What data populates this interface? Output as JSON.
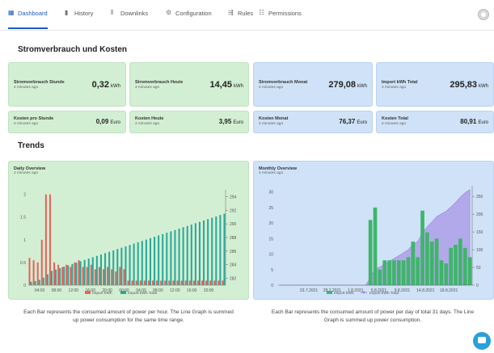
{
  "nav": {
    "tabs": [
      {
        "label": "Dashboard",
        "icon": "grid-icon"
      },
      {
        "label": "History",
        "icon": "bar-chart-icon"
      },
      {
        "label": "Downlinks",
        "icon": "bars-icon"
      },
      {
        "label": "Configuration",
        "icon": "gear-icon"
      },
      {
        "label": "Rules",
        "icon": "rules-icon"
      },
      {
        "label": "Permissions",
        "icon": "users-icon"
      }
    ],
    "active_tab": "Dashboard",
    "accent_color": "#1a5cc7"
  },
  "costs_section": {
    "title": "Stromverbrauch und Kosten",
    "cards": [
      {
        "title": "Stromverbrauch Stunde",
        "subtitle": "4 minutes ago",
        "value": "0,32",
        "unit": "kWh",
        "color": "green"
      },
      {
        "title": "Stromverbrauch Heute",
        "subtitle": "4 minutes ago",
        "value": "14,45",
        "unit": "kWh",
        "color": "green"
      },
      {
        "title": "Stromverbrauch Monat",
        "subtitle": "4 minutes ago",
        "value": "279,08",
        "unit": "kWh",
        "color": "blue"
      },
      {
        "title": "Import kWh Total",
        "subtitle": "4 minutes ago",
        "value": "295,83",
        "unit": "kWh",
        "color": "blue"
      },
      {
        "title": "Kosten pro Stunde",
        "subtitle": "4 minutes ago",
        "value": "0,09",
        "unit": "Euro",
        "color": "green"
      },
      {
        "title": "Kosten Heute",
        "subtitle": "4 minutes ago",
        "value": "3,95",
        "unit": "Euro",
        "color": "green"
      },
      {
        "title": "Kosten Monat",
        "subtitle": "4 minutes ago",
        "value": "76,37",
        "unit": "Euro",
        "color": "blue"
      },
      {
        "title": "Kosten Total",
        "subtitle": "4 minutes ago",
        "value": "80,91",
        "unit": "Euro",
        "color": "blue"
      }
    ]
  },
  "trends_section": {
    "title": "Trends",
    "daily_description": "Each Bar represents the consumed amount of power per hour. The Line Graph is summed up power consumption for the same time range.",
    "monthly_description": "Each Bar represents the consumed amount of power per day of total 31 days. The Line Graph is summed up power consumption."
  },
  "chart_data": [
    {
      "type": "bar",
      "title": "Daily Overview",
      "subtitle": "4 minutes ago",
      "categories": [
        "00:00",
        "01:00",
        "02:00",
        "03:00",
        "04:00",
        "05:00",
        "06:00",
        "07:00",
        "08:00",
        "09:00",
        "10:00",
        "11:00",
        "12:00",
        "13:00",
        "14:00",
        "15:00",
        "16:00",
        "17:00",
        "18:00",
        "19:00",
        "20:00",
        "21:00",
        "22:00",
        "23:00",
        "00:00",
        "01:00",
        "02:00",
        "03:00",
        "04:00",
        "05:00",
        "06:00",
        "07:00",
        "08:00",
        "09:00",
        "10:00",
        "11:00",
        "12:00",
        "13:00",
        "14:00",
        "15:00",
        "16:00",
        "17:00",
        "18:00",
        "19:00",
        "20:00",
        "21:00",
        "22:00",
        "23:00"
      ],
      "x_tick_labels": [
        "04:00",
        "08:00",
        "12:00",
        "16:00",
        "20:00",
        "00:00",
        "04:00",
        "08:00",
        "12:00",
        "16:00",
        "20:00"
      ],
      "series": [
        {
          "name": "Import kWh",
          "color": "#e8615a",
          "values": [
            0.6,
            0.55,
            0.5,
            1.0,
            2.0,
            2.0,
            0.5,
            0.45,
            0.4,
            0.45,
            0.4,
            0.5,
            0.55,
            0.4,
            0.4,
            0.45,
            0.35,
            0.4,
            0.35,
            0.4,
            0.35,
            0.3,
            0.4,
            0.35,
            0.1,
            0.1,
            0.1,
            0.1,
            0.1,
            0.1,
            0.1,
            0.1,
            0.1,
            0.1,
            0.1,
            0.1,
            0.1,
            0.1,
            0.1,
            0.1,
            0.1,
            0.1,
            0.1,
            0.1,
            0.1,
            0.1,
            0.1,
            0.1
          ]
        },
        {
          "name": "Import kWh Total",
          "color": "#2aa89a",
          "values": [
            281.5,
            281.6,
            281.8,
            282.1,
            282.6,
            283.1,
            283.3,
            283.5,
            283.7,
            283.9,
            284.1,
            284.3,
            284.5,
            284.7,
            284.9,
            285.1,
            285.3,
            285.5,
            285.7,
            285.9,
            286.1,
            286.3,
            286.5,
            286.7,
            286.9,
            287.1,
            287.3,
            287.5,
            287.7,
            287.9,
            288.1,
            288.3,
            288.5,
            288.7,
            288.9,
            289.1,
            289.3,
            289.5,
            289.7,
            289.9,
            290.1,
            290.3,
            290.5,
            290.7,
            290.9,
            291.1,
            291.3,
            291.5
          ]
        }
      ],
      "y_left_ticks": [
        "0",
        "0.5",
        "1",
        "1.5",
        "2"
      ],
      "y_right_ticks": [
        "282",
        "284",
        "286",
        "288",
        "290",
        "292",
        "294"
      ],
      "ylim_left": [
        0,
        2.1
      ],
      "ylim_right": [
        281,
        295
      ],
      "legend_position": "bottom"
    },
    {
      "type": "bar",
      "title": "Monthly Overview",
      "subtitle": "4 minutes ago",
      "x_tick_labels": [
        "23.7.2021",
        "28.7.2021",
        "1.8.2021",
        "5.8.2021",
        "9.8.2021",
        "14.8.2021",
        "18.8.2021"
      ],
      "series": [
        {
          "name": "Import kWh",
          "color": "#3fb56a",
          "values": [
            0,
            0,
            0,
            0,
            0,
            0,
            0,
            0,
            0,
            0,
            0,
            0,
            0,
            0,
            0,
            0,
            0,
            0,
            0,
            21,
            25,
            5,
            8,
            8,
            8,
            8,
            8,
            9,
            14,
            9,
            24,
            17,
            14,
            15,
            8,
            7,
            12,
            13,
            15,
            12,
            9
          ]
        },
        {
          "name": "Import kWh Total",
          "color": "#9a7ae0",
          "values": [
            0,
            0,
            0,
            0,
            0,
            0,
            0,
            0,
            0,
            0,
            0,
            0,
            0,
            0,
            0,
            0,
            0,
            0,
            0,
            21,
            46,
            51,
            59,
            67,
            75,
            83,
            91,
            100,
            114,
            123,
            147,
            164,
            178,
            193,
            201,
            208,
            220,
            233,
            248,
            260,
            269
          ]
        }
      ],
      "y_left_ticks": [
        "0",
        "5",
        "10",
        "15",
        "20",
        "25",
        "30"
      ],
      "y_right_ticks": [
        "0",
        "50",
        "100",
        "150",
        "200",
        "250"
      ],
      "ylim_left": [
        0,
        32
      ],
      "ylim_right": [
        0,
        280
      ],
      "legend_position": "bottom"
    }
  ]
}
